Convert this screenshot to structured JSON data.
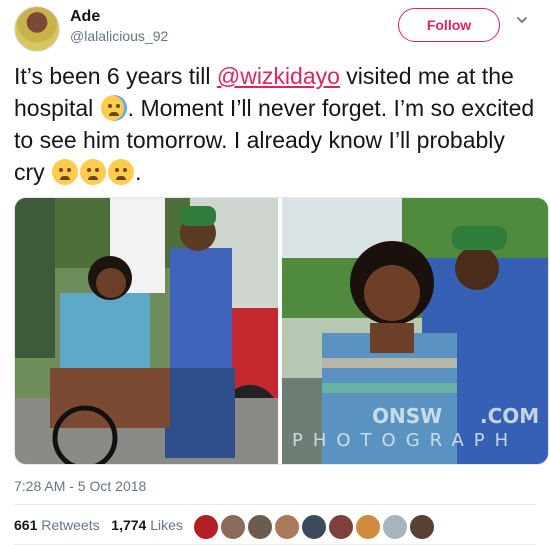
{
  "author": {
    "name": "Ade",
    "handle": "@lalalicious_92"
  },
  "follow_button": {
    "label": "Follow"
  },
  "tweet": {
    "text_1": "It’s been 6 years till ",
    "mention": "@wizkidayo",
    "text_2": " visited me at the hospital ",
    "text_3": ". Moment I’ll never forget. I’m so excited to see him tomorrow. I already know I’ll probably cry ",
    "text_4": "."
  },
  "photo_watermark": {
    "line1": "ONSW",
    "line2": ".COM",
    "line3": "PHOTOGRAPH"
  },
  "timestamp": "7:28 AM - 5 Oct 2018",
  "stats": {
    "retweets_count": "661",
    "retweets_label": "Retweets",
    "likes_count": "1,774",
    "likes_label": "Likes"
  },
  "colors": {
    "accent": "#e0245e",
    "secondary_text": "#657786"
  }
}
